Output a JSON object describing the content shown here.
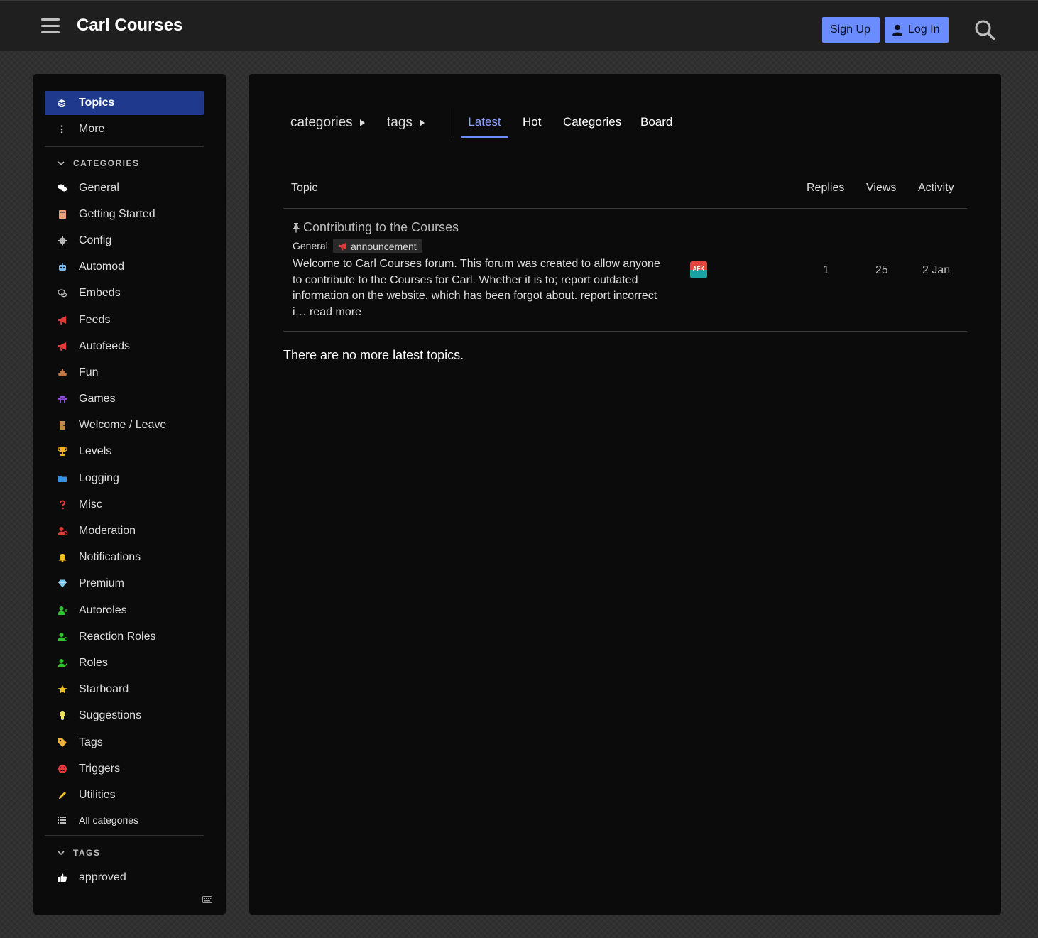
{
  "header": {
    "site_title": "Carl Courses",
    "signup_label": "Sign Up",
    "login_label": "Log In"
  },
  "sidebar": {
    "topics_label": "Topics",
    "more_label": "More",
    "categories_heading": "CATEGORIES",
    "categories": [
      {
        "label": "General",
        "icon": "speech-bubbles-icon",
        "color": "#ffffff"
      },
      {
        "label": "Getting Started",
        "icon": "book-icon",
        "color": "#e8a07a"
      },
      {
        "label": "Config",
        "icon": "gear-icon",
        "color": "#bbbbbb"
      },
      {
        "label": "Automod",
        "icon": "robot-icon",
        "color": "#7ab8e8"
      },
      {
        "label": "Embeds",
        "icon": "chat-outline-icon",
        "color": "#bbbbbb"
      },
      {
        "label": "Feeds",
        "icon": "megaphone-icon",
        "color": "#e03a3a"
      },
      {
        "label": "Autofeeds",
        "icon": "megaphone-icon",
        "color": "#e03a3a"
      },
      {
        "label": "Fun",
        "icon": "poop-icon",
        "color": "#c07a4a"
      },
      {
        "label": "Games",
        "icon": "space-invader-icon",
        "color": "#8a4ad0"
      },
      {
        "label": "Welcome / Leave",
        "icon": "door-icon",
        "color": "#c08a4a"
      },
      {
        "label": "Levels",
        "icon": "trophy-icon",
        "color": "#f0b020"
      },
      {
        "label": "Logging",
        "icon": "folder-icon",
        "color": "#3a90e0"
      },
      {
        "label": "Misc",
        "icon": "question-icon",
        "color": "#e03a3a"
      },
      {
        "label": "Moderation",
        "icon": "user-ban-icon",
        "color": "#e03a3a"
      },
      {
        "label": "Notifications",
        "icon": "bell-icon",
        "color": "#f0c020"
      },
      {
        "label": "Premium",
        "icon": "gem-icon",
        "color": "#7ac8f0"
      },
      {
        "label": "Autoroles",
        "icon": "user-plus-icon",
        "color": "#30c030"
      },
      {
        "label": "Reaction Roles",
        "icon": "user-smile-icon",
        "color": "#30c030"
      },
      {
        "label": "Roles",
        "icon": "user-check-icon",
        "color": "#30c030"
      },
      {
        "label": "Starboard",
        "icon": "star-icon",
        "color": "#f0c020"
      },
      {
        "label": "Suggestions",
        "icon": "lightbulb-icon",
        "color": "#f0e060"
      },
      {
        "label": "Tags",
        "icon": "tag-icon",
        "color": "#f0b040"
      },
      {
        "label": "Triggers",
        "icon": "angry-face-icon",
        "color": "#e03a3a"
      },
      {
        "label": "Utilities",
        "icon": "pencil-icon",
        "color": "#f0c020"
      }
    ],
    "all_categories_label": "All categories",
    "tags_heading": "TAGS",
    "tags": [
      {
        "label": "approved",
        "icon": "thumbs-up-icon",
        "color": "#ffffff"
      }
    ]
  },
  "main": {
    "breadcrumbs": [
      "categories",
      "tags"
    ],
    "tabs": [
      {
        "label": "Latest",
        "active": true
      },
      {
        "label": "Hot",
        "active": false
      },
      {
        "label": "Categories",
        "active": false
      },
      {
        "label": "Board",
        "active": false
      }
    ],
    "columns": {
      "topic": "Topic",
      "replies": "Replies",
      "views": "Views",
      "activity": "Activity"
    },
    "topics": [
      {
        "title": "Contributing to the Courses",
        "category": "General",
        "tag": "announcement",
        "excerpt": "Welcome to Carl Courses forum. This forum was created to allow anyone to contribute to the Courses for Carl. Whether it is to; report outdated information on the website, which has been forgot about. report incorrect i…",
        "read_more": "read more",
        "avatar_text": "AFK",
        "replies": "1",
        "views": "25",
        "activity": "2 Jan"
      }
    ],
    "no_more_text": "There are no more latest topics."
  },
  "colors": {
    "accent": "#6a8cff",
    "active_nav": "#1f3a8c",
    "panel_bg": "#0b0b0b",
    "header_bg": "#1f1f1f"
  }
}
